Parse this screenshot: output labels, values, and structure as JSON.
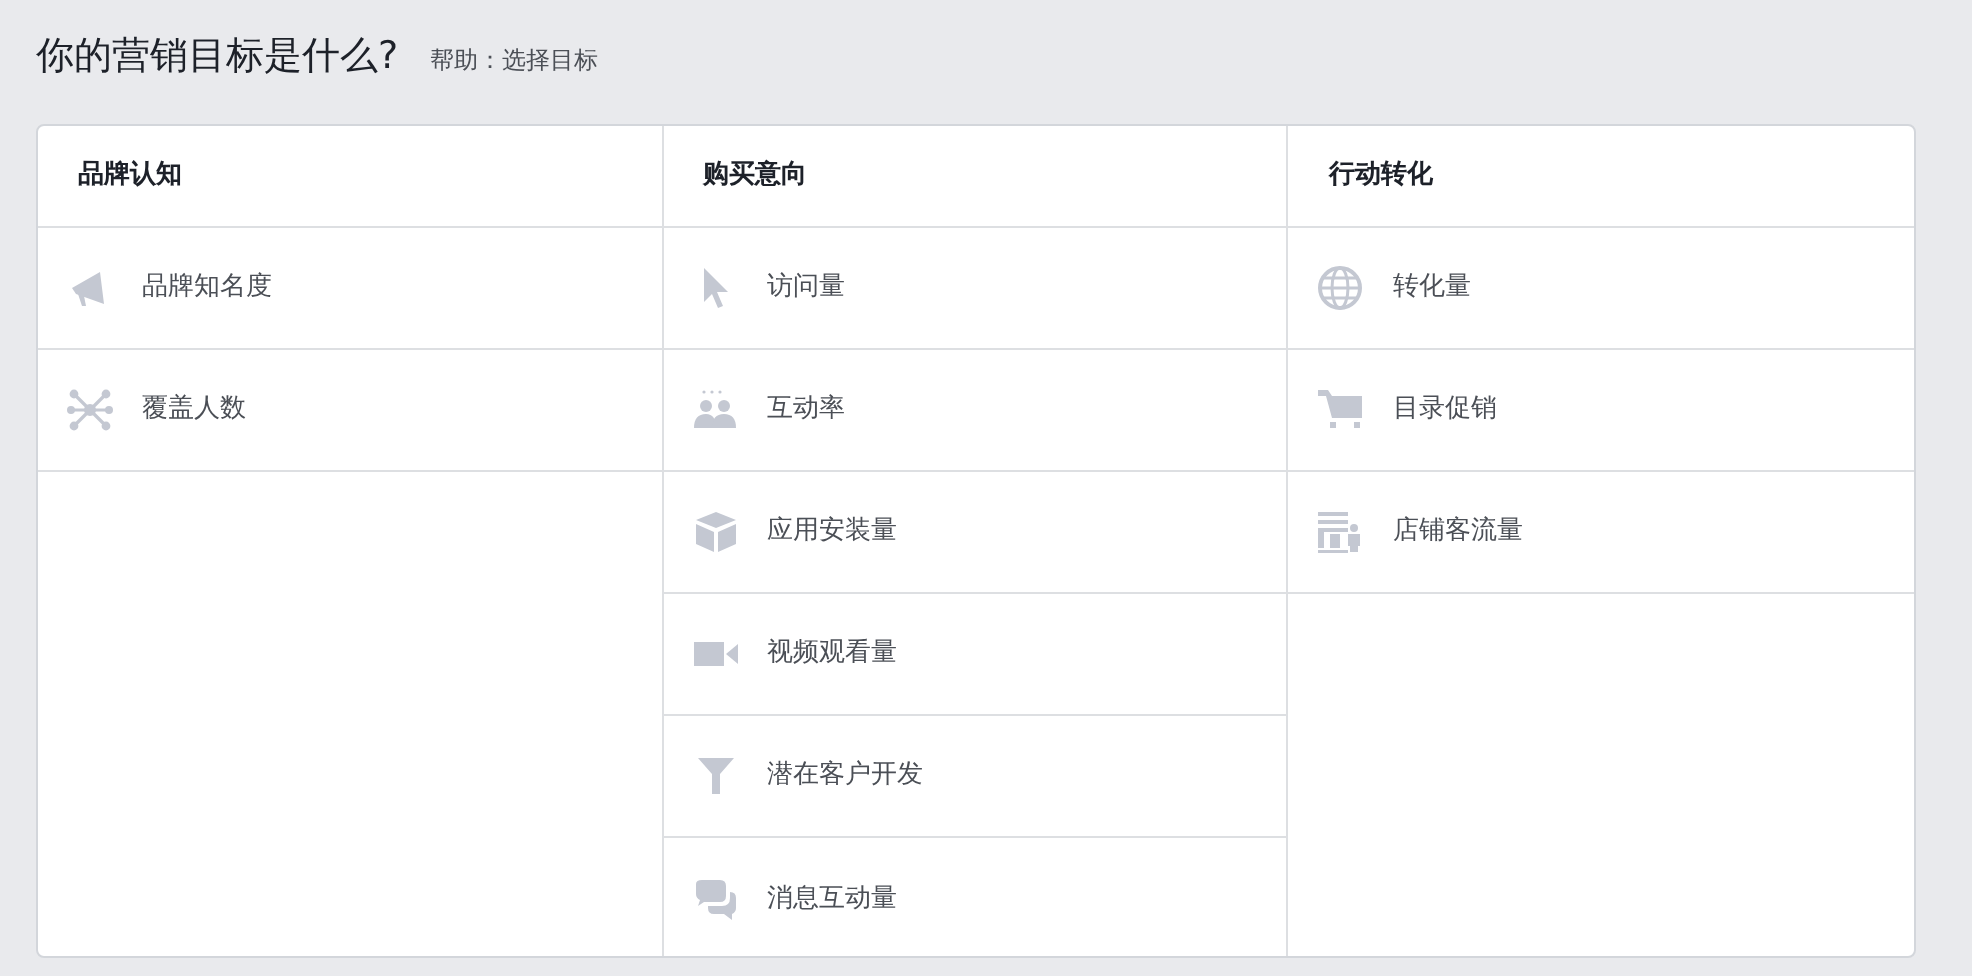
{
  "title": "你的营销目标是什么?",
  "help_link": "帮助：选择目标",
  "columns": [
    {
      "heading": "品牌认知",
      "items": [
        "品牌知名度",
        "覆盖人数"
      ]
    },
    {
      "heading": "购买意向",
      "items": [
        "访问量",
        "互动率",
        "应用安装量",
        "视频观看量",
        "潜在客户开发",
        "消息互动量"
      ]
    },
    {
      "heading": "行动转化",
      "items": [
        "转化量",
        "目录促销",
        "店铺客流量"
      ]
    }
  ]
}
